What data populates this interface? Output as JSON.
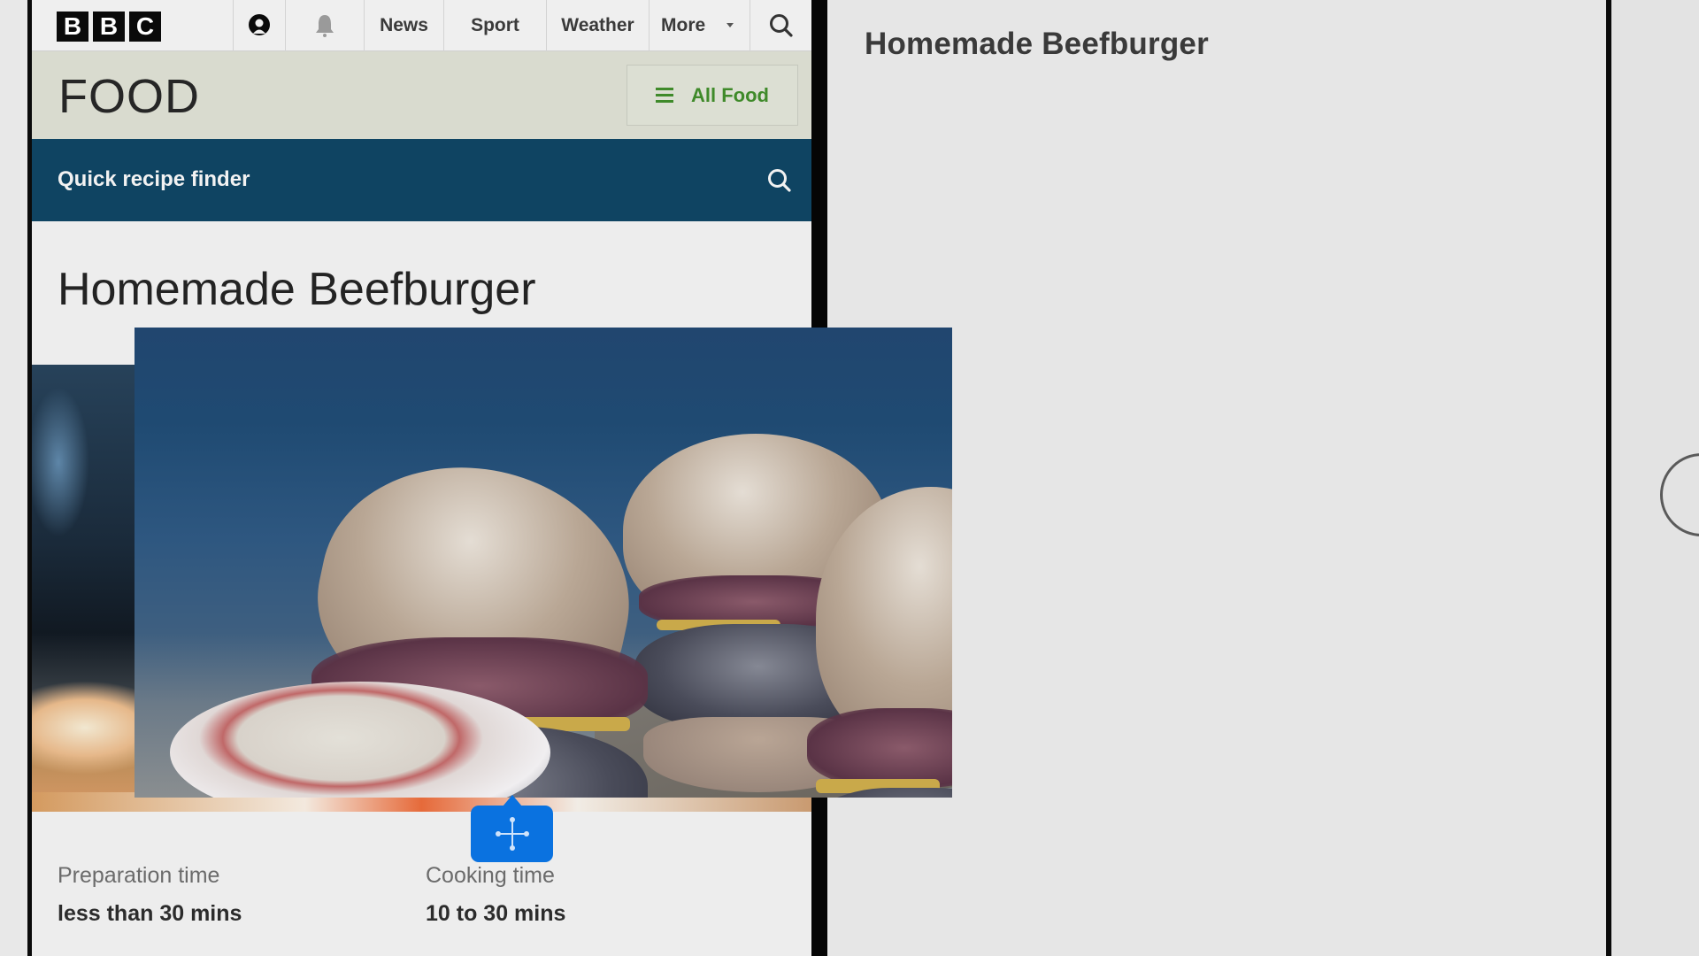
{
  "browser": {
    "nav": {
      "logo_letters": [
        "B",
        "B",
        "C"
      ],
      "account_icon": "account-icon",
      "notification_icon": "bell-icon",
      "links": [
        "News",
        "Sport",
        "Weather"
      ],
      "more_label": "More",
      "search_icon": "search-icon"
    },
    "food_header": {
      "title": "FOOD",
      "all_food_label": "All Food",
      "menu_icon": "hamburger-icon"
    },
    "finder": {
      "label": "Quick recipe finder",
      "search_icon": "search-icon"
    },
    "recipe": {
      "title": "Homemade Beefburger",
      "prep_label": "Preparation time",
      "prep_value": "less than 30 mins",
      "cook_label": "Cooking time",
      "cook_value": "10 to 30 mins"
    },
    "drag": {
      "image_subject": "beefburgers photo",
      "handle_icon": "move-icon"
    }
  },
  "notes_pane": {
    "title": "Homemade Beefburger"
  },
  "colors": {
    "finder_band": "#0f4462",
    "food_band": "#d9dbcf",
    "all_food_green": "#3f8a2a",
    "drag_handle_blue": "#0a72e0"
  }
}
